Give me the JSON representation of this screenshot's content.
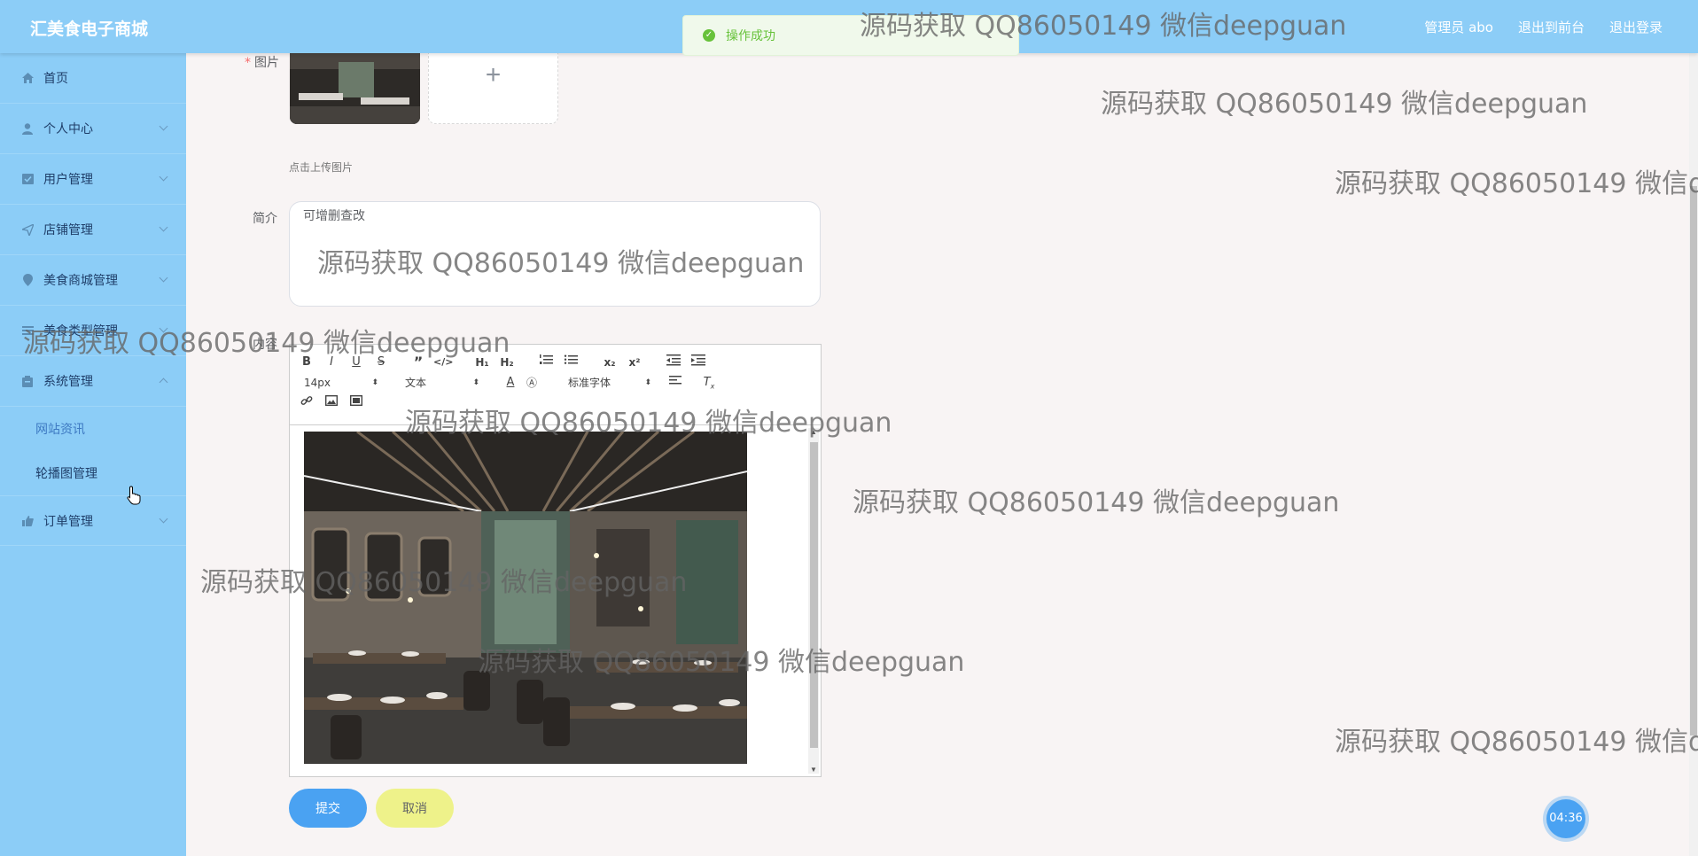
{
  "header": {
    "brand": "汇美食电子商城",
    "admin_label": "管理员 abo",
    "back_to_front": "退出到前台",
    "logout": "退出登录"
  },
  "toast": {
    "message": "操作成功",
    "icon": "check-circle-icon"
  },
  "sidebar": {
    "items": [
      {
        "label": "首页",
        "icon": "home-icon"
      },
      {
        "label": "个人中心",
        "icon": "user-icon"
      },
      {
        "label": "用户管理",
        "icon": "users-icon"
      },
      {
        "label": "店铺管理",
        "icon": "send-icon"
      },
      {
        "label": "美食商城管理",
        "icon": "location-icon"
      },
      {
        "label": "美食类型管理",
        "icon": "list-icon"
      },
      {
        "label": "系统管理",
        "icon": "lock-icon"
      },
      {
        "label": "订单管理",
        "icon": "thumb-icon"
      }
    ],
    "sub_items": [
      {
        "label": "网站资讯"
      },
      {
        "label": "轮播图管理"
      }
    ]
  },
  "form": {
    "image_label": "图片",
    "upload_hint": "点击上传图片",
    "intro_label": "简介",
    "intro_value": "可增删查改",
    "content_label": "内容",
    "editor": {
      "font_size": "14px",
      "block_type": "文本",
      "font_family": "标准字体"
    },
    "submit_label": "提交",
    "cancel_label": "取消"
  },
  "timer": "04:36",
  "watermark": "源码获取 QQ86050149 微信deepguan",
  "colors": {
    "header_bg": "#8ccdf7",
    "submit_bg": "#4aa2f2",
    "cancel_bg": "#eef28a",
    "success": "#67c23a"
  }
}
